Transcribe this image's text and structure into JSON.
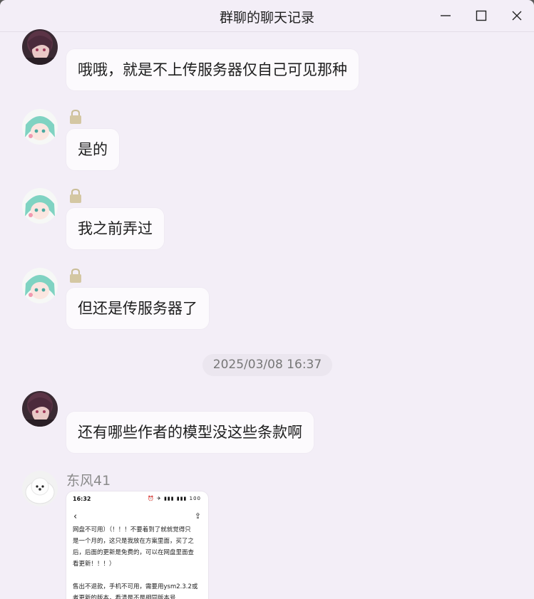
{
  "window": {
    "title": "群聊的聊天记录",
    "minimize_icon": "minimize-icon",
    "maximize_icon": "maximize-icon",
    "close_icon": "close-icon"
  },
  "messages": [
    {
      "text": "哦哦，就是不上传服务器仅自己可见那种"
    },
    {
      "text": "是的"
    },
    {
      "text": "我之前弄过"
    },
    {
      "text": "但还是传服务器了"
    },
    {
      "text": "还有哪些作者的模型没这些条款啊"
    }
  ],
  "timestamp": "2025/03/08 16:37",
  "image_message": {
    "sender": "东风41",
    "status_time": "16:32",
    "status_icons": "⏰ ✈ ▮▮▮ ▮▮▮ 100",
    "back_icon": "‹",
    "share_icon": "⇪",
    "lines": [
      "网盘不可用）（！！！不要着到了就就觉得只",
      "是一个月的，这只是我放在方案里面，买了之",
      "后，后面的更新是免费的，可以在网盘里面查",
      "看更新！！！）",
      "",
      "售出不退款，手机不可用，需要用ysm2.3.2或",
      "者更新的版本，看清是不是相同版本号"
    ]
  },
  "colors": {
    "window_bg": "#f3eef7",
    "bubble_bg": "#fcfafd",
    "lock_color": "#d4c7a3"
  }
}
